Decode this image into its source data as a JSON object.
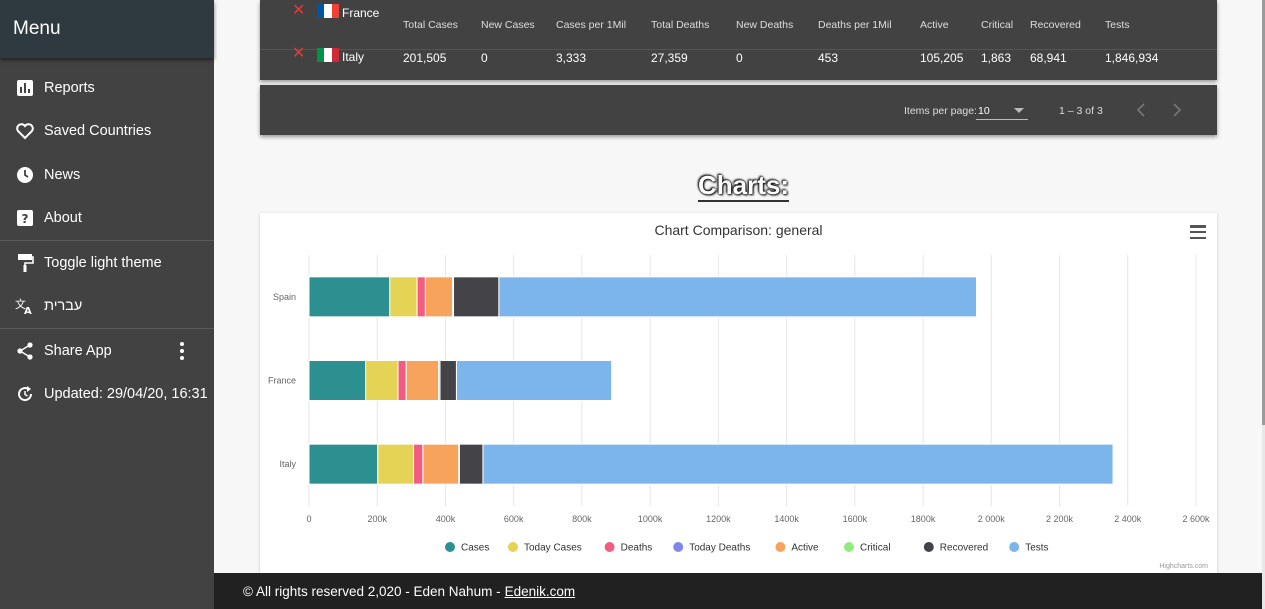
{
  "sidebar": {
    "title": "Menu",
    "items": [
      {
        "label": "Reports",
        "icon": "bar-chart-icon"
      },
      {
        "label": "Saved Countries",
        "icon": "heart-icon"
      },
      {
        "label": "News",
        "icon": "clock-icon"
      },
      {
        "label": "About",
        "icon": "help-icon"
      },
      {
        "label": "Toggle light theme",
        "icon": "paint-roller-icon"
      },
      {
        "label": "עברית",
        "icon": "translate-icon"
      },
      {
        "label": "Share App",
        "icon": "share-icon"
      },
      {
        "label": "Updated: 29/04/20, 16:31",
        "icon": "refresh-icon"
      }
    ]
  },
  "table": {
    "headers": [
      "Total Cases",
      "New Cases",
      "Cases per 1Mil",
      "Total Deaths",
      "New Deaths",
      "Deaths per 1Mil",
      "Active",
      "Critical",
      "Recovered",
      "Tests"
    ],
    "rows": [
      {
        "country": "France",
        "flag": [
          "#0055a4",
          "#ffffff",
          "#ef4135"
        ],
        "values": []
      },
      {
        "country": "Italy",
        "flag": [
          "#009246",
          "#ffffff",
          "#ce2b37"
        ],
        "values": [
          "201,505",
          "0",
          "3,333",
          "27,359",
          "0",
          "453",
          "105,205",
          "1,863",
          "68,941",
          "1,846,934"
        ]
      }
    ]
  },
  "paginator": {
    "items_per_page_label": "Items per page:",
    "items_per_page_value": "10",
    "range_label": "1 – 3 of 3"
  },
  "charts_heading": "Charts:",
  "chart_data": {
    "type": "bar",
    "stacked": true,
    "orientation": "horizontal",
    "title": "Chart Comparison: general",
    "categories": [
      "Spain",
      "France",
      "Italy"
    ],
    "xlim": [
      0,
      2600000
    ],
    "tick_labels": [
      "0",
      "200k",
      "400k",
      "600k",
      "800k",
      "1000k",
      "1200k",
      "1400k",
      "1600k",
      "1800k",
      "2 000k",
      "2 200k",
      "2 400k",
      "2 600k"
    ],
    "grid": true,
    "legend_position": "bottom",
    "series": [
      {
        "name": "Cases",
        "color": "#2b908f",
        "values": [
          236899,
          165911,
          201505
        ]
      },
      {
        "name": "Today Cases",
        "color": "#e4d354",
        "values": [
          80000,
          95000,
          105000
        ]
      },
      {
        "name": "Deaths",
        "color": "#f15c80",
        "values": [
          24275,
          24087,
          27359
        ]
      },
      {
        "name": "Today Deaths",
        "color": "#8085e9",
        "values": [
          0,
          0,
          0
        ]
      },
      {
        "name": "Active",
        "color": "#f7a35c",
        "values": [
          80000,
          95000,
          105205
        ]
      },
      {
        "name": "Critical",
        "color": "#90ed7d",
        "values": [
          2500,
          4000,
          1863
        ]
      },
      {
        "name": "Recovered",
        "color": "#434348",
        "values": [
          132929,
          48228,
          68941
        ]
      },
      {
        "name": "Tests",
        "color": "#7cb5ec",
        "values": [
          1400000,
          455000,
          1846934
        ]
      }
    ],
    "credits": "Highcharts.com"
  },
  "footer": {
    "text": "© All rights reserved 2,020 - Eden Nahum - ",
    "link": "Edenik.com"
  }
}
